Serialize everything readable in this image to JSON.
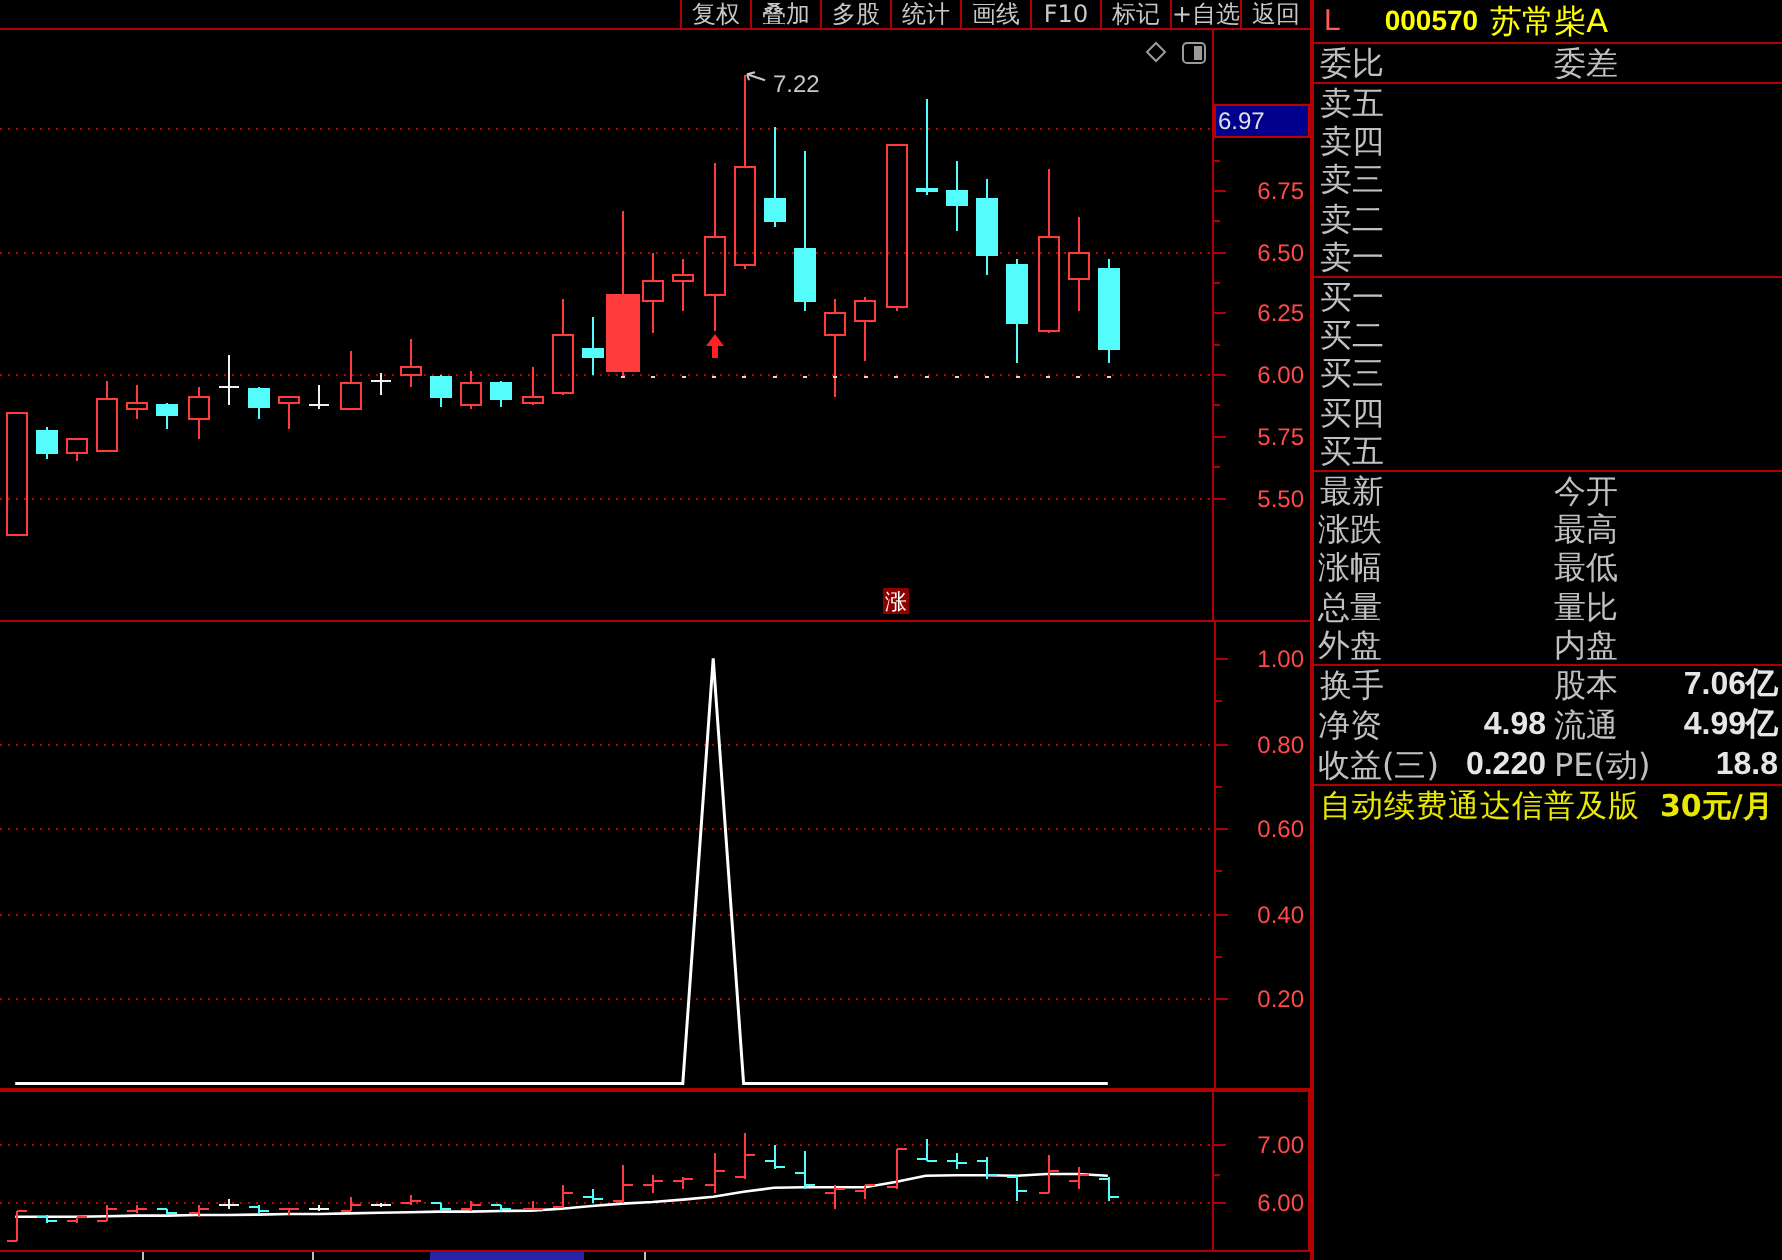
{
  "toolbar": {
    "buttons": [
      "复权",
      "叠加",
      "多股",
      "统计",
      "画线",
      "F10",
      "标记",
      "+自选",
      "返回"
    ]
  },
  "price_chart": {
    "axis_labels": [
      "6.75",
      "6.50",
      "6.25",
      "6.00",
      "5.75",
      "5.50"
    ],
    "price_tag": "6.97",
    "high_label": "7.22",
    "signal_label": "涨"
  },
  "indicator_chart": {
    "chart_data": {
      "type": "line",
      "grid": true,
      "ylim": [
        -0.013,
        1.088
      ],
      "yticks": [
        {
          "value": 0.2,
          "label": "0.20"
        },
        {
          "value": 0.4,
          "label": "0.40"
        },
        {
          "value": 0.6,
          "label": "0.60"
        },
        {
          "value": 0.8,
          "label": "0.80"
        },
        {
          "value": 1.0,
          "label": "1.00"
        }
      ],
      "series": [
        {
          "color": "#ffffff",
          "values": [
            0,
            0,
            0,
            0,
            0,
            0,
            0,
            0,
            0,
            0,
            0,
            0,
            0,
            0,
            0,
            0,
            0,
            0,
            0,
            0,
            0,
            0,
            0,
            1,
            0,
            0,
            0,
            0,
            0,
            0,
            0,
            0,
            0,
            0,
            0,
            0,
            0,
            null,
            null,
            null
          ]
        }
      ]
    }
  },
  "overview_chart": {
    "chart_data": {
      "type": "line",
      "grid": true,
      "ylim": [
        5.14,
        7.947
      ],
      "yticks": [
        {
          "value": 6.0,
          "label": "6.00"
        },
        {
          "value": 7.0,
          "label": "7.00"
        }
      ],
      "series": [
        {
          "color": "#ffffff",
          "values": [
            5.74,
            5.74,
            5.74,
            5.75,
            5.76,
            5.76,
            5.77,
            5.77,
            5.78,
            5.79,
            5.79,
            5.8,
            5.81,
            5.82,
            5.83,
            5.83,
            5.84,
            5.85,
            5.88,
            5.93,
            5.97,
            6.0,
            6.04,
            6.09,
            6.18,
            6.25,
            6.26,
            6.26,
            6.26,
            6.35,
            6.46,
            6.47,
            6.47,
            6.46,
            6.49,
            6.49,
            6.46,
            null,
            null,
            null
          ]
        }
      ]
    }
  },
  "quote_panel": {
    "market_flag": "L",
    "stock_code": "000570",
    "stock_name": "苏常柴A",
    "order_book_header": [
      {
        "label": "委比"
      },
      {
        "label": "委差"
      }
    ],
    "asks": [
      "卖五",
      "卖四",
      "卖三",
      "卖二",
      "卖一"
    ],
    "bids": [
      "买一",
      "买二",
      "买三",
      "买四",
      "买五"
    ],
    "quote_fields": [
      {
        "label": "最新"
      },
      {
        "label": "今开"
      },
      {
        "label": "涨跌"
      },
      {
        "label": "最高"
      },
      {
        "label": "涨幅"
      },
      {
        "label": "最低"
      },
      {
        "label": "总量"
      },
      {
        "label": "量比"
      },
      {
        "label": "外盘"
      },
      {
        "label": "内盘"
      }
    ],
    "fundamentals": [
      {
        "label": "换手"
      },
      {
        "label": "股本",
        "value": "7.06亿"
      },
      {
        "label": "净资",
        "value": "4.98"
      },
      {
        "label": "流通",
        "value": "4.99亿"
      },
      {
        "label": "收益(三)",
        "value": "0.220"
      },
      {
        "label": "PE(动)",
        "value": "18.8"
      }
    ],
    "promo": {
      "text": "自动续费通达信普及版",
      "price": "30元/月"
    }
  }
}
